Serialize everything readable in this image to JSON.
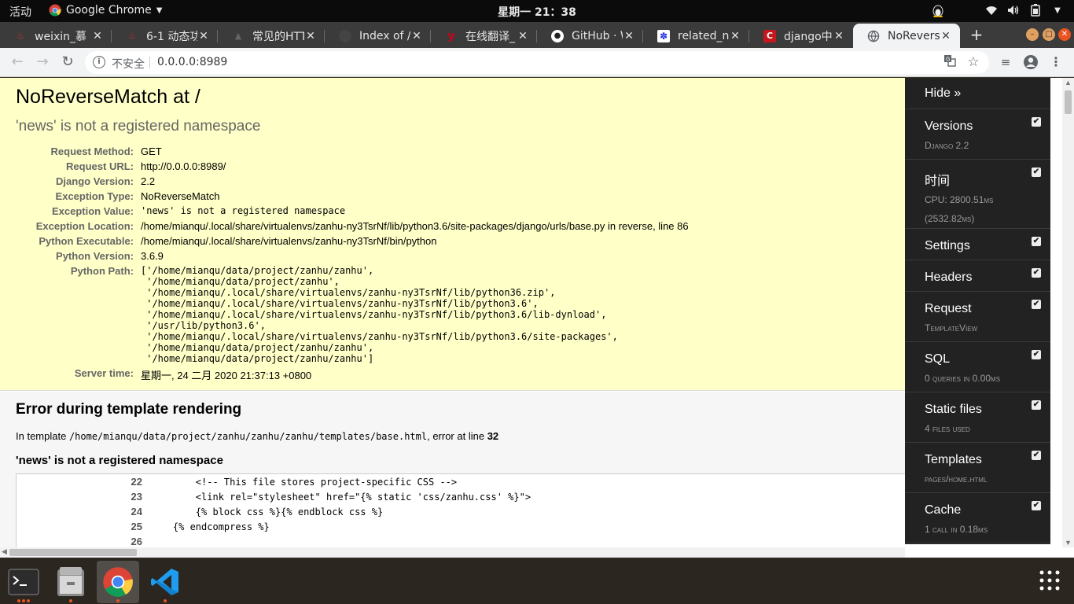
{
  "topbar": {
    "activities": "活动",
    "app_name": "Google Chrome",
    "clock": "星期一 21：38"
  },
  "tabs": [
    {
      "title": "weixin_慕",
      "fav_color": "#d6372c"
    },
    {
      "title": "6-1 动态功",
      "fav_color": "#d6372c"
    },
    {
      "title": "常见的HTT",
      "fav_color": "#555555"
    },
    {
      "title": "Index of /A",
      "fav_color": "#444444"
    },
    {
      "title": "在线翻译_",
      "fav_color": "#d0021b"
    },
    {
      "title": "GitHub · W",
      "fav_color": "#ffffff"
    },
    {
      "title": "related_na",
      "fav_color": "#2932e1"
    },
    {
      "title": "django中r",
      "fav_color": "#c8161d"
    },
    {
      "title": "NoReverse",
      "fav_color": "#5f6368"
    }
  ],
  "address_bar": {
    "security": "不安全",
    "url": "0.0.0.0:8989"
  },
  "error": {
    "title": "NoReverseMatch at /",
    "message": "'news' is not a registered namespace",
    "meta": [
      {
        "key": "Request Method:",
        "value": "GET",
        "mono": false
      },
      {
        "key": "Request URL:",
        "value": "http://0.0.0.0:8989/",
        "mono": false
      },
      {
        "key": "Django Version:",
        "value": "2.2",
        "mono": false
      },
      {
        "key": "Exception Type:",
        "value": "NoReverseMatch",
        "mono": false
      },
      {
        "key": "Exception Value:",
        "value": "'news' is not a registered namespace",
        "mono": true
      },
      {
        "key": "Exception Location:",
        "value": "/home/mianqu/.local/share/virtualenvs/zanhu-ny3TsrNf/lib/python3.6/site-packages/django/urls/base.py in reverse, line 86",
        "mono": false
      },
      {
        "key": "Python Executable:",
        "value": "/home/mianqu/.local/share/virtualenvs/zanhu-ny3TsrNf/bin/python",
        "mono": false
      },
      {
        "key": "Python Version:",
        "value": "3.6.9",
        "mono": false
      }
    ],
    "python_path_label": "Python Path:",
    "python_path": "['/home/mianqu/data/project/zanhu/zanhu',\n '/home/mianqu/data/project/zanhu',\n '/home/mianqu/.local/share/virtualenvs/zanhu-ny3TsrNf/lib/python36.zip',\n '/home/mianqu/.local/share/virtualenvs/zanhu-ny3TsrNf/lib/python3.6',\n '/home/mianqu/.local/share/virtualenvs/zanhu-ny3TsrNf/lib/python3.6/lib-dynload',\n '/usr/lib/python3.6',\n '/home/mianqu/.local/share/virtualenvs/zanhu-ny3TsrNf/lib/python3.6/site-packages',\n '/home/mianqu/data/project/zanhu/zanhu',\n '/home/mianqu/data/project/zanhu/zanhu']",
    "server_time_label": "Server time:",
    "server_time": "星期一, 24 二月 2020 21:37:13 +0800"
  },
  "template_error": {
    "heading": "Error during template rendering",
    "info_prefix": "In template ",
    "info_path": "/home/mianqu/data/project/zanhu/zanhu/zanhu/templates/base.html",
    "info_suffix": ", error at line ",
    "info_line": "32",
    "message": "'news' is not a registered namespace",
    "source_lines": [
      {
        "num": "22",
        "code": "        <!-- This file stores project-specific CSS -->"
      },
      {
        "num": "23",
        "code": "        <link rel=\"stylesheet\" href=\"{% static 'css/zanhu.css' %}\">"
      },
      {
        "num": "24",
        "code": "        {% block css %}{% endblock css %}"
      },
      {
        "num": "25",
        "code": "    {% endcompress %}"
      },
      {
        "num": "26",
        "code": ""
      }
    ]
  },
  "debug_toolbar": {
    "hide_label": "Hide »",
    "panels": [
      {
        "title": "Versions",
        "sub": "Django 2.2",
        "checked": true
      },
      {
        "title": "时间",
        "sub": "CPU: 2800.51ms\n(2532.82ms)",
        "checked": true
      },
      {
        "title": "Settings",
        "sub": "",
        "checked": true
      },
      {
        "title": "Headers",
        "sub": "",
        "checked": true
      },
      {
        "title": "Request",
        "sub": "TemplateView",
        "checked": true
      },
      {
        "title": "SQL",
        "sub": "0 queries in 0.00ms",
        "checked": true
      },
      {
        "title": "Static files",
        "sub": "4 files used",
        "checked": true
      },
      {
        "title": "Templates",
        "sub": "pages/home.html",
        "checked": true
      },
      {
        "title": "Cache",
        "sub": "1 call in 0.18ms",
        "checked": true
      }
    ]
  },
  "dock": {
    "apps": [
      {
        "name": "terminal",
        "dots": 3
      },
      {
        "name": "files",
        "dots": 1
      },
      {
        "name": "chrome",
        "dots": 1
      },
      {
        "name": "vscode",
        "dots": 1
      }
    ]
  },
  "colors": {
    "summary_bg": "#ffffc8",
    "toolbar_bg": "#222222",
    "dock_dot": "#e95420"
  }
}
